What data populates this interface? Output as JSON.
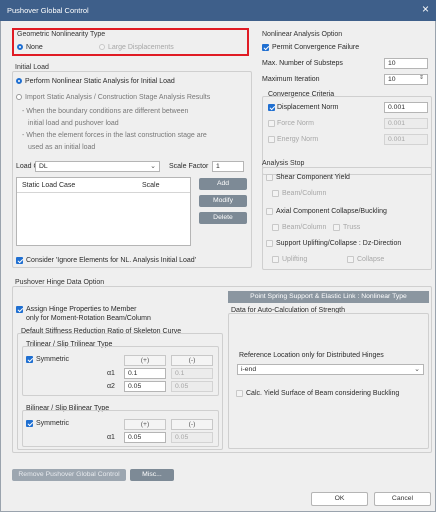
{
  "window": {
    "title": "Pushover Global Control",
    "close": "×"
  },
  "geo": {
    "title": "Geometric Nonlinearity Type",
    "none": "None",
    "large": "Large Displacements"
  },
  "init": {
    "title": "Initial Load",
    "opt1": "Perform Nonlinear Static Analysis for Initial Load",
    "opt2": "Import Static Analysis / Construction Stage Analysis Results",
    "b1a": "- When the boundary conditions are different between",
    "b1b": "initial load and pushover load",
    "b2a": "- When the element forces in the last construction stage are",
    "b2b": "used as an initial load",
    "load_case_label": "Load Case",
    "load_case_value": "DL",
    "scale_label": "Scale Factor",
    "scale_value": "1",
    "col1": "Static Load Case",
    "col2": "Scale",
    "add": "Add",
    "modify": "Modify",
    "delete": "Delete",
    "ignore": "Consider 'Ignore Elements for NL. Analysis Initial Load'"
  },
  "nl": {
    "title": "Nonlinear Analysis Option",
    "permit": "Permit Convergence Failure",
    "substeps_label": "Max. Number of Substeps",
    "substeps_value": "10",
    "iter_label": "Maximum Iteration",
    "iter_value": "10",
    "crit_title": "Convergence Criteria",
    "disp": "Displacement Norm",
    "disp_v": "0.001",
    "force": "Force Norm",
    "force_v": "0.001",
    "energy": "Energy Norm",
    "energy_v": "0.001"
  },
  "stop": {
    "title": "Analysis Stop",
    "shear": "Shear Component Yield",
    "beam": "Beam/Column",
    "axial": "Axial Component Collapse/Buckling",
    "beam2": "Beam/Column",
    "truss": "Truss",
    "support": "Support Uplifting/Collapse : Dz-Direction",
    "uplift": "Uplifting",
    "collapse": "Collapse"
  },
  "hinge": {
    "title": "Pushover Hinge Data Option",
    "assign1": "Assign Hinge Properties to Member",
    "assign2": "only for Moment-Rotation Beam/Column",
    "default_title": "Default Stiffness Reduction Ratio of Skeleton Curve",
    "tri_title": "Trilinear / Slip Trilinear Type",
    "sym": "Symmetric",
    "plus": "(+)",
    "minus": "(-)",
    "a1": "α1",
    "a1p": "0.1",
    "a1m": "0.1",
    "a2": "α2",
    "a2p": "0.05",
    "a2m": "0.05",
    "bi_title": "Bilinear / Slip Bilinear Type",
    "sym2": "Symmetric",
    "plus2": "(+)",
    "minus2": "(-)",
    "b1": "α1",
    "b1p": "0.05",
    "b1m": "0.05"
  },
  "spring": {
    "button": "Point Spring Support & Elastic Link : Nonlinear Type",
    "data_title": "Data for Auto-Calculation of Strength",
    "ref_title": "Reference Location only for Distributed Hinges",
    "ref_value": "i-end",
    "calc": "Calc. Yield Surface of Beam considering Buckling"
  },
  "bottom": {
    "remove": "Remove Pushover Global Control",
    "misc": "Misc...",
    "ok": "OK",
    "cancel": "Cancel"
  }
}
